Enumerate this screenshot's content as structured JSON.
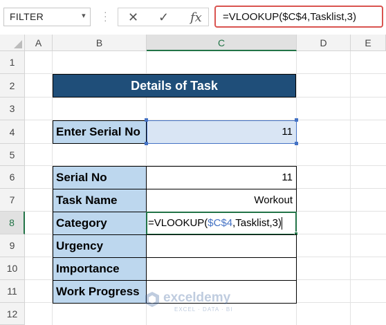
{
  "name_box": {
    "value": "FILTER"
  },
  "formula_bar": {
    "cancel_icon": "cancel-icon",
    "enter_icon": "enter-icon",
    "fx_label": "fx",
    "formula": "=VLOOKUP($C$4,Tasklist,3)"
  },
  "columns": [
    "A",
    "B",
    "C",
    "D",
    "E"
  ],
  "rows": [
    "1",
    "2",
    "3",
    "4",
    "5",
    "6",
    "7",
    "8",
    "9",
    "10",
    "11",
    "12"
  ],
  "sheet": {
    "title": "Details of Task",
    "input_label": "Enter Serial No",
    "input_value": "11",
    "details": [
      {
        "label": "Serial No",
        "value": "11"
      },
      {
        "label": "Task Name",
        "value": "Workout"
      },
      {
        "label": "Category",
        "value": ""
      },
      {
        "label": "Urgency",
        "value": ""
      },
      {
        "label": "Importance",
        "value": ""
      },
      {
        "label": "Work Progress",
        "value": ""
      }
    ],
    "edit_prefix": "=VLOOKUP(",
    "edit_ref": "$C$4",
    "edit_suffix": ",Tasklist,3)"
  },
  "colors": {
    "header": "#1f4e79",
    "label_fill": "#bdd7ee",
    "ref_blue": "#4472c4",
    "selection": "#217346"
  },
  "watermark": {
    "name": "exceldemy",
    "tagline": "EXCEL · DATA · BI"
  }
}
